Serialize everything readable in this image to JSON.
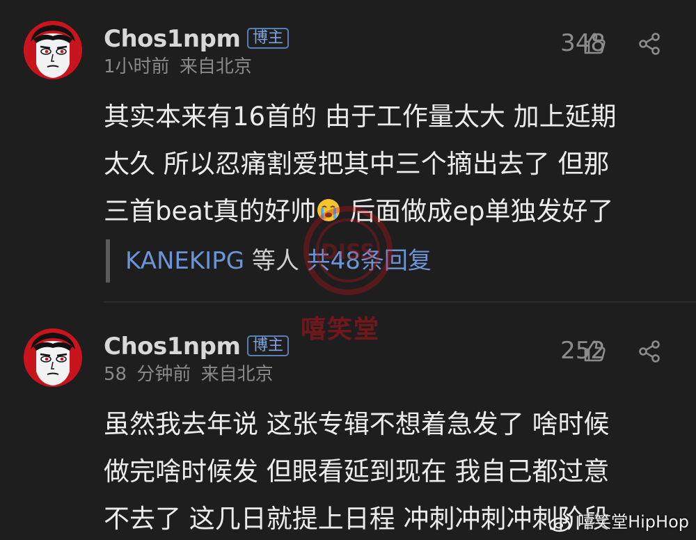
{
  "comments": [
    {
      "username": "Chos1npm",
      "badge": "博主",
      "time": "1小时前",
      "location": "来自北京",
      "likes": "348",
      "lines": [
        "其实本来有16首的 由于工作量太大 加上延期",
        "太久 所以忍痛割爱把其中三个摘出去了 但那",
        "三首beat真的好帅",
        " 后面做成ep单独发好了"
      ],
      "reply_users": "KANEKIPG",
      "reply_mid": " 等人 ",
      "reply_count": "共48条回复"
    },
    {
      "username": "Chos1npm",
      "badge": "博主",
      "time": "58 分钟前",
      "location": "来自北京",
      "likes": "252",
      "lines": [
        "虽然我去年说 这张专辑不想着急发了 啥时候",
        "做完啥时候发 但眼看延到现在 我自己都过意",
        "不去了 这几日就提上日程 冲刺冲刺冲刺阶段"
      ]
    }
  ],
  "watermark": {
    "center_mark": "DISS",
    "center_text": "嘻笑堂",
    "corner_text": "嘻笑堂HipHop"
  },
  "icons": {
    "like": "thumbs-up-icon",
    "share": "share-icon",
    "weibo": "weibo-icon",
    "emoji": "crying-face-emoji"
  },
  "colors": {
    "background": "#1e1e1e",
    "link": "#6c95d8",
    "badge": "#7fa6e0"
  }
}
